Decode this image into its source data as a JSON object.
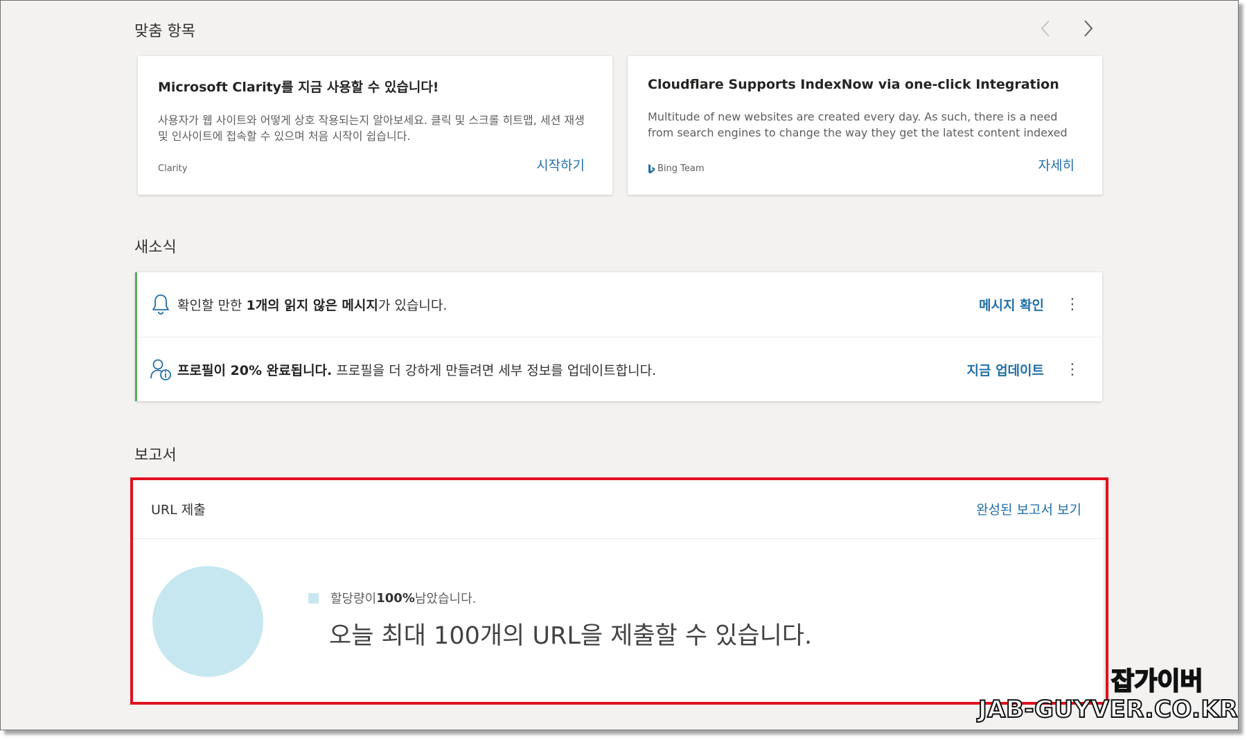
{
  "sections": {
    "recommended_title": "맞춤 항목",
    "news_title": "새소식",
    "reports_title": "보고서"
  },
  "cards": [
    {
      "title": "Microsoft Clarity를 지금 사용할 수 있습니다!",
      "description": "사용자가 웹 사이트와 어떻게 상호 작용되는지 알아보세요. 클릭 및 스크롤 히트맵, 세션 재생 및 인사이트에 접속할 수 있으며 처음 시작이 쉽습니다.",
      "source": "Clarity",
      "link": "시작하기"
    },
    {
      "title": "Cloudflare Supports IndexNow via one-click Integration",
      "description": "Multitude of new websites are created every day. As such, there is a need from search engines to change the way they get the latest content indexed as soon as..",
      "source": "Bing Team",
      "link": "자세히"
    }
  ],
  "notifications": [
    {
      "pre": "확인할 만한 ",
      "bold": "1개의 읽지 않은 메시지",
      "post": "가 있습니다.",
      "action": "메시지 확인",
      "icon": "bell-icon"
    },
    {
      "pre": "",
      "bold": "프로필이 20% 완료됩니다.",
      "post": " 프로필을 더 강하게 만들려면 세부 정보를 업데이트합니다.",
      "action": "지금 업데이트",
      "icon": "profile-info-icon"
    }
  ],
  "report": {
    "title": "URL 제출",
    "link": "완성된 보고서 보기",
    "legend_pre": "할당량이 ",
    "legend_value": "100%",
    "legend_post": " 남았습니다.",
    "message": "오늘 최대 100개의 URL을 제출할 수 있습니다.",
    "pie_color": "#c6e7f0",
    "remaining_fraction": 1.0
  },
  "watermark": {
    "line1": "잡가이버",
    "line2": "JAB-GUYVER.CO.KR"
  },
  "colors": {
    "accent": "#1f6ea8",
    "notif_border": "#5aa85d",
    "highlight": "#e0101e"
  }
}
